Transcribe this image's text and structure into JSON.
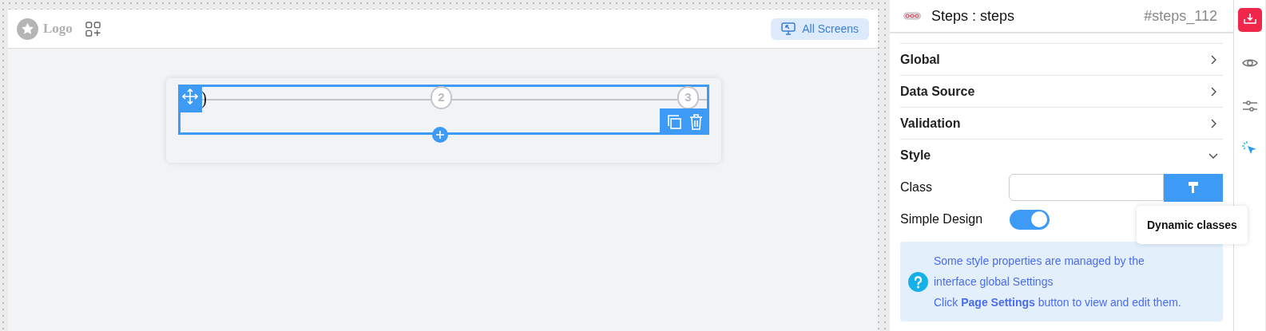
{
  "header": {
    "logo": "Logo",
    "all_screens": "All Screens"
  },
  "steps": [
    {
      "label": "2"
    },
    {
      "label": "3"
    }
  ],
  "panel": {
    "title": "Steps : steps",
    "id": "#steps_112",
    "sections": [
      {
        "label": "Global",
        "expanded": false
      },
      {
        "label": "Data Source",
        "expanded": false
      },
      {
        "label": "Validation",
        "expanded": false
      },
      {
        "label": "Style",
        "expanded": true
      }
    ],
    "class_field": {
      "label": "Class"
    },
    "tooltip": "Dynamic classes",
    "simple_design": {
      "label": "Simple Design",
      "on": true
    },
    "info": {
      "lines": [
        "Some style properties are managed by the",
        "interface global Settings",
        "Click **Page Settings** button to view and edit them."
      ]
    }
  },
  "rail": [
    {
      "selected": true
    },
    {
      "selected": false
    },
    {
      "selected": false
    },
    {
      "selected": false
    }
  ]
}
